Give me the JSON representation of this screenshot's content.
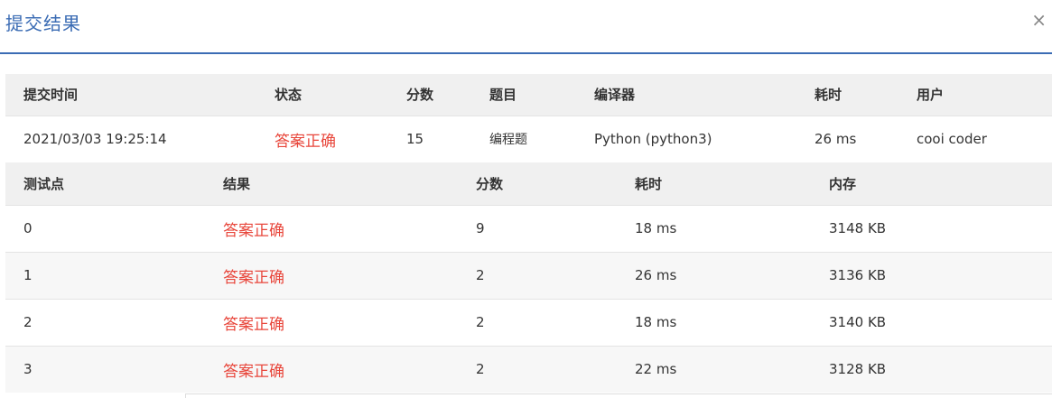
{
  "dialog": {
    "title": "提交结果",
    "close_label": "×"
  },
  "summary": {
    "headers": [
      "提交时间",
      "状态",
      "分数",
      "题目",
      "编译器",
      "耗时",
      "用户"
    ],
    "row": {
      "time": "2021/03/03 19:25:14",
      "status": "答案正确",
      "score": "15",
      "problem": "编程题",
      "compiler": "Python (python3)",
      "elapsed": "26 ms",
      "user": "cooi coder"
    }
  },
  "cases": {
    "headers": [
      "测试点",
      "结果",
      "分数",
      "耗时",
      "内存"
    ],
    "rows": [
      {
        "id": "0",
        "result": "答案正确",
        "score": "9",
        "time": "18 ms",
        "memory": "3148 KB"
      },
      {
        "id": "1",
        "result": "答案正确",
        "score": "2",
        "time": "26 ms",
        "memory": "3136 KB"
      },
      {
        "id": "2",
        "result": "答案正确",
        "score": "2",
        "time": "18 ms",
        "memory": "3140 KB"
      },
      {
        "id": "3",
        "result": "答案正确",
        "score": "2",
        "time": "22 ms",
        "memory": "3128 KB"
      }
    ]
  },
  "colors": {
    "accent": "#3b6cb4",
    "success_text": "#e8463b",
    "header_bg": "#f0f0f0"
  }
}
